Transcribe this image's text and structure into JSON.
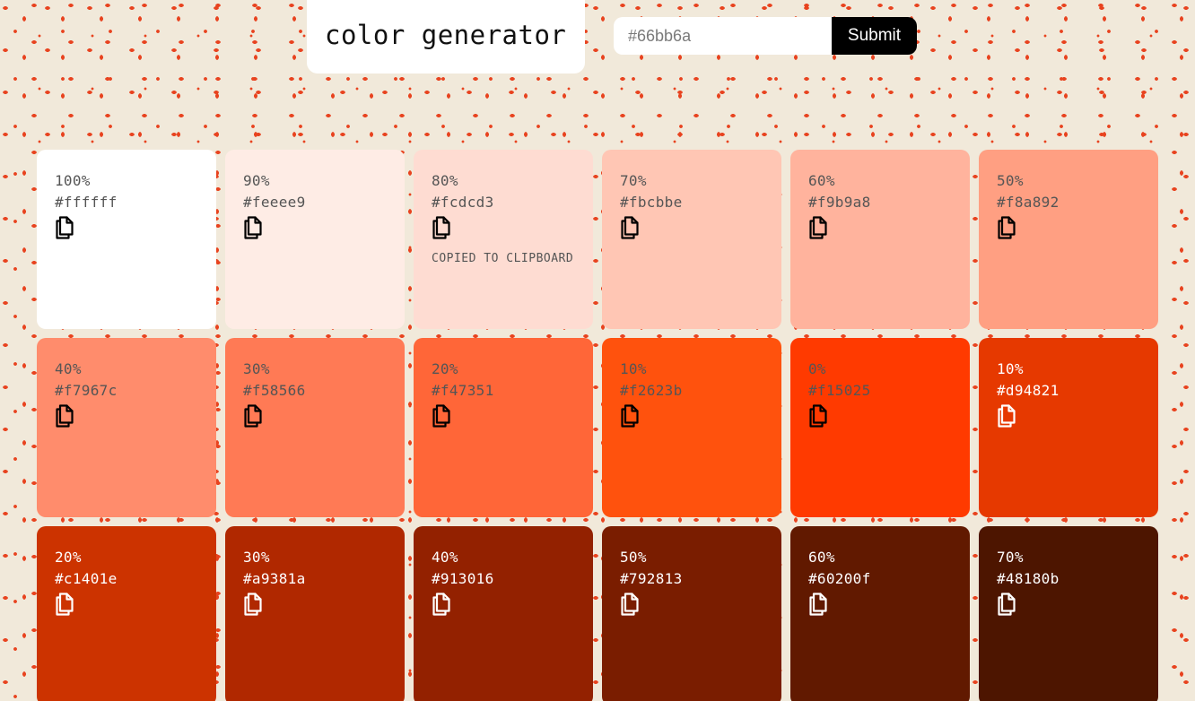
{
  "header": {
    "title": "color generator"
  },
  "form": {
    "placeholder": "#66bb6a",
    "value": "",
    "submit_label": "Submit"
  },
  "swatches": [
    {
      "weight": "100%",
      "hex": "#ffffff",
      "dark": false,
      "copied_label": ""
    },
    {
      "weight": "90%",
      "hex": "#feeee9",
      "dark": false,
      "copied_label": ""
    },
    {
      "weight": "80%",
      "hex": "#fcdcd3",
      "dark": false,
      "copied_label": "copied to clipboard"
    },
    {
      "weight": "70%",
      "hex": "#fbcbbe",
      "dark": false,
      "copied_label": ""
    },
    {
      "weight": "60%",
      "hex": "#f9b9a8",
      "dark": false,
      "copied_label": ""
    },
    {
      "weight": "50%",
      "hex": "#f8a892",
      "dark": false,
      "copied_label": ""
    },
    {
      "weight": "40%",
      "hex": "#f7967c",
      "dark": false,
      "copied_label": ""
    },
    {
      "weight": "30%",
      "hex": "#f58566",
      "dark": false,
      "copied_label": ""
    },
    {
      "weight": "20%",
      "hex": "#f47351",
      "dark": false,
      "copied_label": ""
    },
    {
      "weight": "10%",
      "hex": "#f2623b",
      "dark": false,
      "copied_label": ""
    },
    {
      "weight": "0%",
      "hex": "#f15025",
      "dark": false,
      "copied_label": ""
    },
    {
      "weight": "10%",
      "hex": "#d94821",
      "dark": true,
      "copied_label": ""
    },
    {
      "weight": "20%",
      "hex": "#c1401e",
      "dark": true,
      "copied_label": ""
    },
    {
      "weight": "30%",
      "hex": "#a9381a",
      "dark": true,
      "copied_label": ""
    },
    {
      "weight": "40%",
      "hex": "#913016",
      "dark": true,
      "copied_label": ""
    },
    {
      "weight": "50%",
      "hex": "#792813",
      "dark": true,
      "copied_label": ""
    },
    {
      "weight": "60%",
      "hex": "#60200f",
      "dark": true,
      "copied_label": ""
    },
    {
      "weight": "70%",
      "hex": "#48180b",
      "dark": true,
      "copied_label": ""
    }
  ],
  "display_colors": [
    "#ffffff",
    "#feece5",
    "#fedcd2",
    "#ffc6b4",
    "#ffb39d",
    "#ff9f82",
    "#ff8c6c",
    "#ff7a55",
    "#ff6638",
    "#ff520d",
    "#ff3a00",
    "#e63900",
    "#cc3300",
    "#b02800",
    "#932100",
    "#7a1d00",
    "#611900",
    "#4d1500"
  ],
  "icons": {
    "copy": "copy-icon"
  },
  "colors": {
    "background": "#f1e9da",
    "speckle": "#e8431f",
    "submit_bg": "#000000",
    "submit_text": "#ffffff"
  }
}
